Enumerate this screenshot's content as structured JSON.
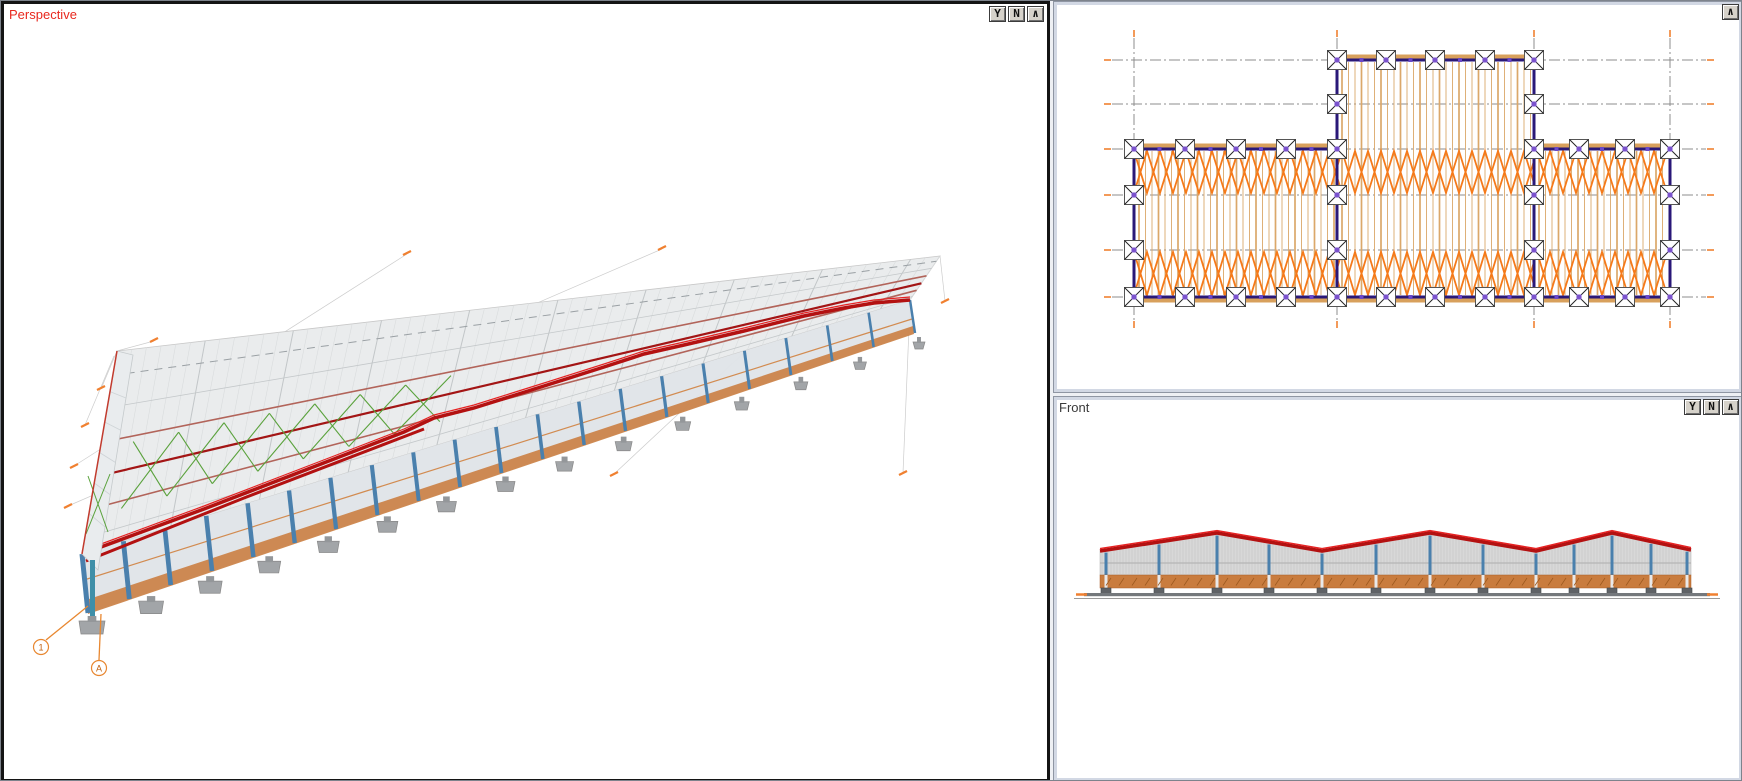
{
  "perspective": {
    "title": "Perspective",
    "buttons": [
      "Y",
      "N",
      "∧"
    ],
    "axis_labels": [
      "1",
      "A"
    ]
  },
  "plan": {
    "buttons": [
      "∧"
    ]
  },
  "front": {
    "title": "Front",
    "buttons": [
      "Y",
      "N",
      "∧"
    ]
  },
  "colors": {
    "perspective_title": "#e8281e",
    "front_title": "#3a3a3a",
    "edge_purple": "#2a1878",
    "joist_tan": "#dba86a",
    "bracing_orange": "#f57a1a",
    "girt_orange": "#c97c3e",
    "column_blue": "#4a80ad",
    "roof_red": "#b31111",
    "roof_bright_red": "#e62222",
    "bracing_green": "#5aa23c",
    "concrete_gray": "#a2a5a8",
    "grid_gray": "#8c8c8c",
    "tick_orange": "#f08030",
    "eave_tan": "#d8a05c"
  }
}
